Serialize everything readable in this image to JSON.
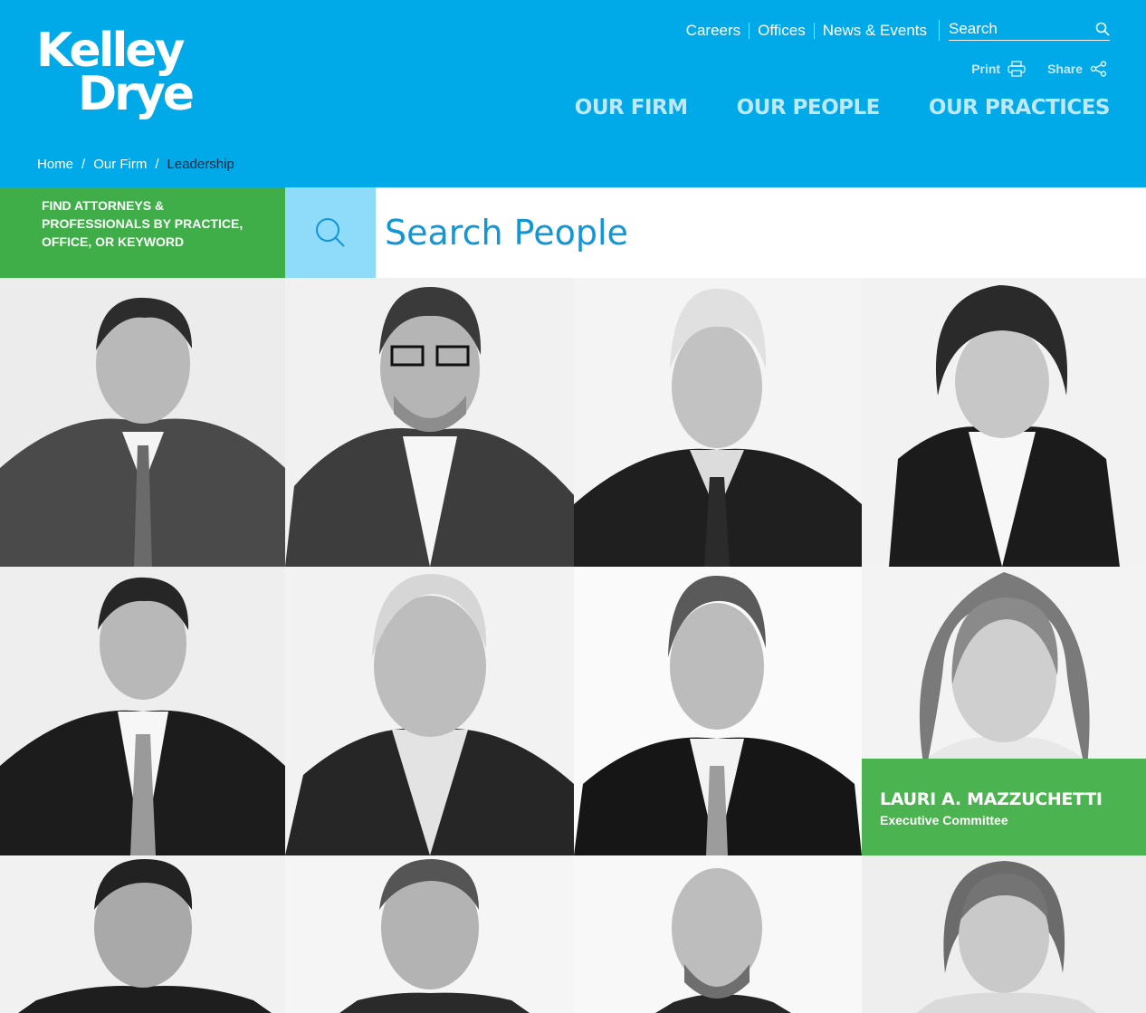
{
  "logo": {
    "line1": "Kelley",
    "line2": "Drye"
  },
  "utility_nav": [
    "Careers",
    "Offices",
    "News & Events"
  ],
  "search": {
    "label": "Search"
  },
  "tools": {
    "print": "Print",
    "share": "Share"
  },
  "main_nav": [
    "OUR FIRM",
    "OUR PEOPLE",
    "OUR PRACTICES"
  ],
  "breadcrumb": {
    "home": "Home",
    "section": "Our Firm",
    "current": "Leadership"
  },
  "finder": {
    "text": "FIND ATTORNEYS & PROFESSIONALS BY PRACTICE, OFFICE, OR KEYWORD"
  },
  "people_search": {
    "placeholder": "Search People"
  },
  "featured_person": {
    "name": "LAURI A. MAZZUCHETTI",
    "role": "Executive Committee"
  },
  "colors": {
    "header_blue": "#00a9e8",
    "green": "#3fae49",
    "light_blue": "#8edcfa",
    "text_blue": "#1296d6"
  }
}
